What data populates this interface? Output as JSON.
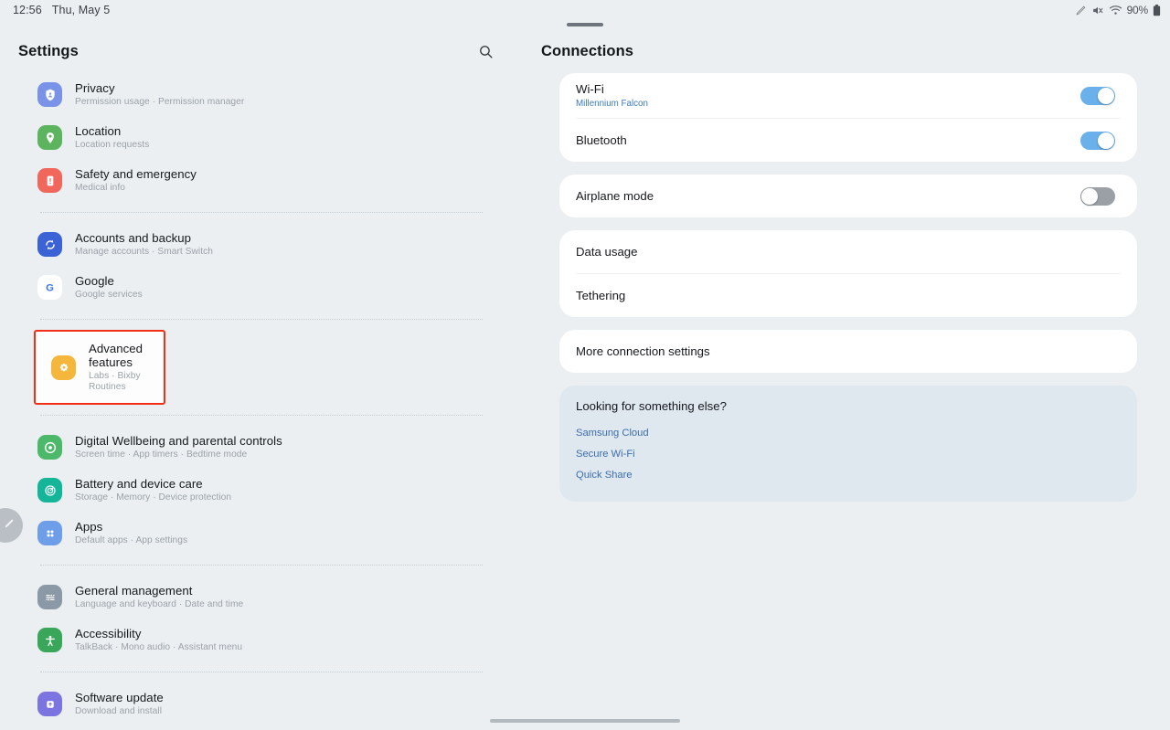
{
  "statusbar": {
    "time": "12:56",
    "date": "Thu, May 5",
    "battery_percent": "90%",
    "icons": [
      "pen-icon",
      "mute-icon",
      "wifi-icon",
      "battery-icon"
    ]
  },
  "left_pane": {
    "title": "Settings",
    "search_icon": "search-icon",
    "edge_handle_icon": "pencil-icon",
    "groups": [
      {
        "items": [
          {
            "title": "Privacy",
            "subtitle": "Permission usage  ·  Permission manager",
            "icon": "shield-person-icon",
            "color": "#7a93e8",
            "highlighted": false
          },
          {
            "title": "Location",
            "subtitle": "Location requests",
            "icon": "location-pin-icon",
            "color": "#5cb45f",
            "highlighted": false
          },
          {
            "title": "Safety and emergency",
            "subtitle": "Medical info",
            "icon": "emergency-alert-icon",
            "color": "#f2675b",
            "highlighted": false
          }
        ]
      },
      {
        "items": [
          {
            "title": "Accounts and backup",
            "subtitle": "Manage accounts  ·  Smart Switch",
            "icon": "sync-icon",
            "color": "#3b63d6",
            "highlighted": false
          },
          {
            "title": "Google",
            "subtitle": "Google services",
            "icon": "google-g-icon",
            "color": "#ffffff",
            "highlighted": false
          }
        ]
      },
      {
        "items": [
          {
            "title": "Advanced features",
            "subtitle": "Labs  ·  Bixby Routines",
            "icon": "advanced-features-icon",
            "color": "#f5b63c",
            "highlighted": true
          }
        ]
      },
      {
        "items": [
          {
            "title": "Digital Wellbeing and parental controls",
            "subtitle": "Screen time  ·  App timers  ·  Bedtime mode",
            "icon": "wellbeing-icon",
            "color": "#4cb86a",
            "highlighted": false
          },
          {
            "title": "Battery and device care",
            "subtitle": "Storage  ·  Memory  ·  Device protection",
            "icon": "device-care-icon",
            "color": "#15b59a",
            "highlighted": false
          },
          {
            "title": "Apps",
            "subtitle": "Default apps  ·  App settings",
            "icon": "apps-grid-icon",
            "color": "#6f9ee8",
            "highlighted": false
          }
        ]
      },
      {
        "items": [
          {
            "title": "General management",
            "subtitle": "Language and keyboard  ·  Date and time",
            "icon": "sliders-icon",
            "color": "#8b99a6",
            "highlighted": false
          },
          {
            "title": "Accessibility",
            "subtitle": "TalkBack  ·  Mono audio  ·  Assistant menu",
            "icon": "accessibility-person-icon",
            "color": "#3aa65a",
            "highlighted": false
          }
        ]
      },
      {
        "items": [
          {
            "title": "Software update",
            "subtitle": "Download and install",
            "icon": "software-update-icon",
            "color": "#7c74e0",
            "highlighted": false
          }
        ]
      }
    ]
  },
  "right_pane": {
    "title": "Connections",
    "cards": [
      {
        "type": "toggle_list",
        "rows": [
          {
            "title": "Wi-Fi",
            "subtitle": "Millennium Falcon",
            "toggle": "on"
          },
          {
            "title": "Bluetooth",
            "subtitle": "",
            "toggle": "on"
          }
        ]
      },
      {
        "type": "toggle_list",
        "rows": [
          {
            "title": "Airplane mode",
            "subtitle": "",
            "toggle": "off"
          }
        ]
      },
      {
        "type": "plain_list",
        "rows": [
          {
            "title": "Data usage"
          },
          {
            "title": "Tethering"
          }
        ]
      },
      {
        "type": "plain_list",
        "rows": [
          {
            "title": "More connection settings"
          }
        ]
      }
    ],
    "info_card": {
      "title": "Looking for something else?",
      "links": [
        "Samsung Cloud",
        "Secure Wi-Fi",
        "Quick Share"
      ]
    }
  },
  "colors": {
    "page_background": "#eceff1",
    "card_background": "#ffffff",
    "info_card_background": "#dfe7ef",
    "highlight_border": "#ef2f16",
    "link_blue": "#3c6fad",
    "toggle_on": "#6ab0ea",
    "toggle_off": "#9aa0a6"
  }
}
